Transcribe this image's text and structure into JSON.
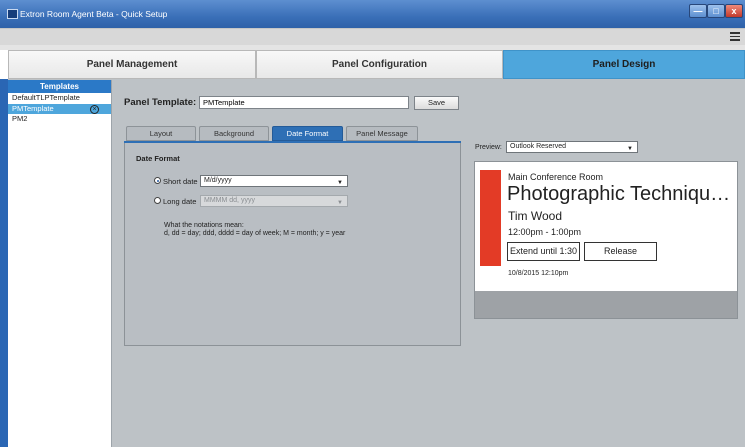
{
  "window": {
    "title": "Extron Room Agent Beta - Quick Setup",
    "min_glyph": "—",
    "max_glyph": "□",
    "close_glyph": "x"
  },
  "main_tabs": [
    {
      "label": "Panel Management",
      "active": false
    },
    {
      "label": "Panel Configuration",
      "active": false
    },
    {
      "label": "Panel Design",
      "active": true
    }
  ],
  "sidebar": {
    "header": "Templates",
    "items": [
      {
        "label": "DefaultTLPTemplate",
        "selected": false
      },
      {
        "label": "PMTemplate",
        "selected": true
      },
      {
        "label": "PM2",
        "selected": false
      }
    ],
    "delete_glyph": "×"
  },
  "panel_template": {
    "label": "Panel Template:",
    "value": "PMTemplate",
    "save_label": "Save"
  },
  "sub_tabs": [
    {
      "label": "Layout",
      "active": false
    },
    {
      "label": "Background",
      "active": false
    },
    {
      "label": "Date Format",
      "active": true
    },
    {
      "label": "Panel Message",
      "active": false
    }
  ],
  "date_format": {
    "title": "Date Format",
    "short_label": "Short date",
    "short_value": "M/d/yyyy",
    "short_selected": true,
    "long_label": "Long date",
    "long_value": "MMMM dd, yyyy",
    "notation_title": "What the notations mean:",
    "notation_text": "d, dd = day; ddd, dddd = day of week; M = month; y = year"
  },
  "preview": {
    "label": "Preview:",
    "selected": "Outlook Reserved",
    "room_name": "Main Conference Room",
    "meeting_title": "Photographic Techniques Seminar",
    "organizer": "Tim Wood",
    "time": "12:00pm - 1:00pm",
    "extend_label": "Extend until 1:30",
    "release_label": "Release",
    "date": "10/8/2015 12:10pm",
    "status_color": "#e33b26"
  },
  "colors": {
    "accent": "#4ea6dc",
    "titlebar": "#3a6fb8",
    "active_subtab": "#2e6fb5"
  }
}
